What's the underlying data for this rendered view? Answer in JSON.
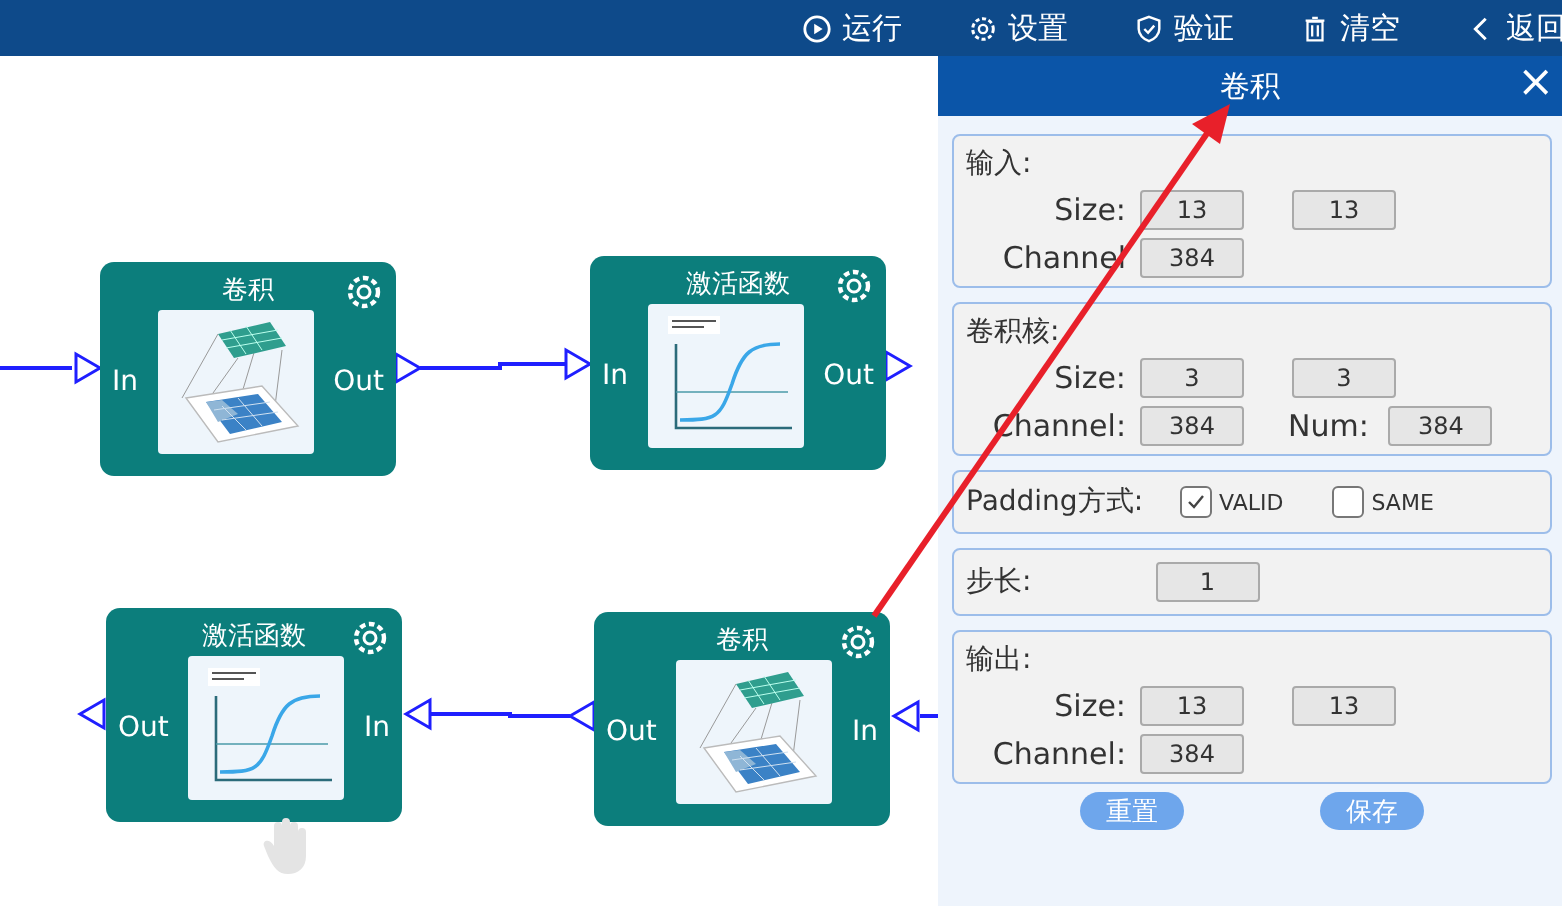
{
  "toolbar": [
    {
      "kind": "play",
      "label": "运行"
    },
    {
      "kind": "gear",
      "label": "设置"
    },
    {
      "kind": "shield",
      "label": "验证"
    },
    {
      "kind": "trash",
      "label": "清空"
    },
    {
      "kind": "back",
      "label": "返回"
    }
  ],
  "canvas": {
    "nodes": [
      {
        "title": "卷积",
        "kind": "conv",
        "left": "In",
        "right": "Out"
      },
      {
        "title": "激活函数",
        "kind": "activation",
        "left": "In",
        "right": "Out"
      },
      {
        "title": "激活函数",
        "kind": "activation",
        "left": "Out",
        "right": "In"
      },
      {
        "title": "卷积",
        "kind": "conv",
        "left": "Out",
        "right": "In"
      }
    ]
  },
  "panel": {
    "title": "卷积",
    "close": "×",
    "sections": [
      {
        "kind": "fields",
        "title": "输入:",
        "rows": [
          [
            {
              "label": "Size:",
              "value": "13"
            },
            {
              "value": "13"
            }
          ],
          [
            {
              "label": "Channel",
              "value": "384"
            }
          ]
        ]
      },
      {
        "kind": "fields",
        "title": "卷积核:",
        "rows": [
          [
            {
              "label": "Size:",
              "value": "3"
            },
            {
              "value": "3"
            }
          ],
          [
            {
              "label": "Channel:",
              "value": "384"
            },
            {
              "label": "Num:",
              "value": "384"
            }
          ]
        ]
      },
      {
        "kind": "options",
        "title": "Padding方式:",
        "options": [
          {
            "label": "VALID",
            "checked": true
          },
          {
            "label": "SAME",
            "checked": false
          }
        ]
      },
      {
        "kind": "inline",
        "title": "步长:",
        "value": "1"
      },
      {
        "kind": "fields",
        "title": "输出:",
        "rows": [
          [
            {
              "label": "Size:",
              "value": "13"
            },
            {
              "value": "13"
            }
          ],
          [
            {
              "label": "Channel:",
              "value": "384"
            }
          ]
        ]
      }
    ],
    "buttons": [
      "重置",
      "保存"
    ]
  }
}
